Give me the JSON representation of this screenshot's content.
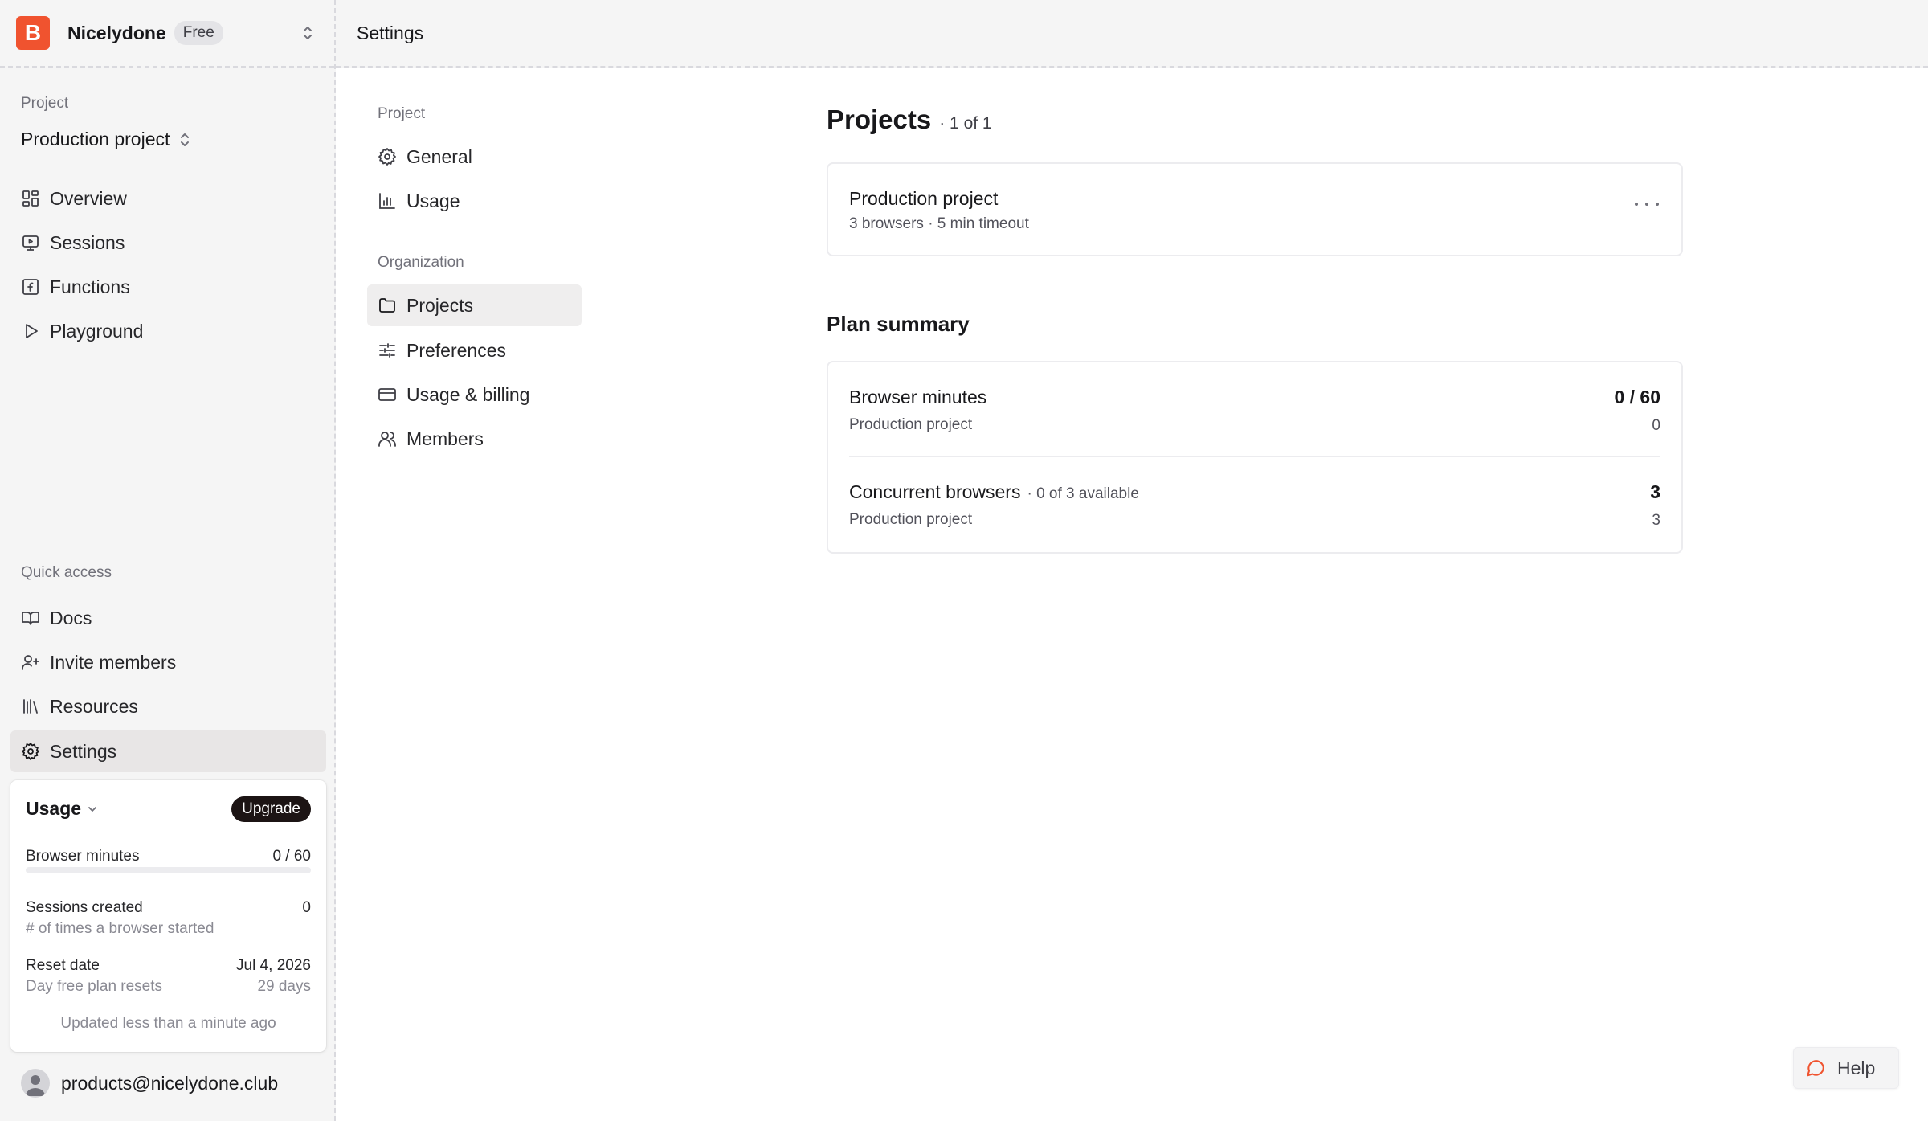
{
  "org": {
    "logo_letter": "B",
    "name": "Nicelydone",
    "plan": "Free"
  },
  "sidebar": {
    "project_label": "Project",
    "project_name": "Production project",
    "nav": [
      {
        "label": "Overview",
        "icon": "grid-icon"
      },
      {
        "label": "Sessions",
        "icon": "monitor-icon"
      },
      {
        "label": "Functions",
        "icon": "function-icon"
      },
      {
        "label": "Playground",
        "icon": "play-icon"
      }
    ],
    "quick_access_label": "Quick access",
    "quick": [
      {
        "label": "Docs",
        "icon": "book-icon"
      },
      {
        "label": "Invite members",
        "icon": "user-plus-icon"
      },
      {
        "label": "Resources",
        "icon": "library-icon"
      },
      {
        "label": "Settings",
        "icon": "gear-icon",
        "active": true
      }
    ],
    "usage": {
      "title": "Usage",
      "upgrade": "Upgrade",
      "browser_minutes_label": "Browser minutes",
      "browser_minutes_value": "0 / 60",
      "browser_minutes_progress": 0,
      "sessions_label": "Sessions created",
      "sessions_value": "0",
      "sessions_sub": "# of times a browser started",
      "reset_label": "Reset date",
      "reset_value": "Jul 4, 2026",
      "reset_sub": "Day free plan resets",
      "reset_days": "29 days",
      "updated": "Updated less than a minute ago"
    },
    "user_email": "products@nicelydone.club"
  },
  "header": {
    "title": "Settings"
  },
  "settings_nav": {
    "project_label": "Project",
    "project_items": [
      {
        "label": "General",
        "icon": "gear-icon"
      },
      {
        "label": "Usage",
        "icon": "bar-chart-icon"
      }
    ],
    "org_label": "Organization",
    "org_items": [
      {
        "label": "Projects",
        "icon": "folder-icon",
        "active": true
      },
      {
        "label": "Preferences",
        "icon": "sliders-icon"
      },
      {
        "label": "Usage & billing",
        "icon": "credit-card-icon"
      },
      {
        "label": "Members",
        "icon": "users-icon"
      }
    ]
  },
  "main": {
    "title": "Projects",
    "count": "· 1 of 1",
    "project": {
      "name": "Production project",
      "meta": "3 browsers · 5 min timeout"
    },
    "plan_title": "Plan summary",
    "plan_rows": [
      {
        "name": "Browser minutes",
        "aux": "",
        "value": "0 / 60",
        "sub": "Production project",
        "sub_value": "0"
      },
      {
        "name": "Concurrent browsers",
        "aux": "· 0 of 3 available",
        "value": "3",
        "sub": "Production project",
        "sub_value": "3"
      }
    ]
  },
  "help": {
    "label": "Help"
  },
  "colors": {
    "brand": "#f0532f",
    "dark_button": "#1c1414"
  }
}
